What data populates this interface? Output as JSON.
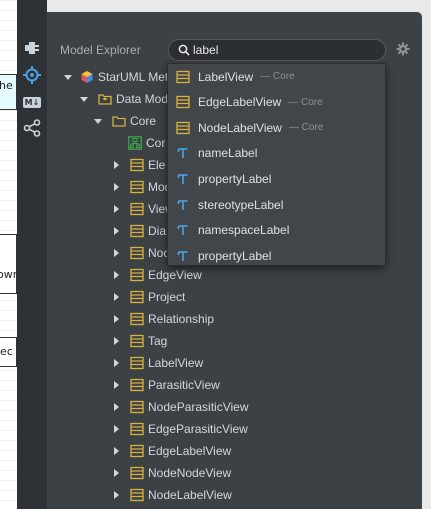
{
  "canvas": {
    "fragments": [
      "he",
      "own",
      "lec"
    ]
  },
  "panel": {
    "title": "Model Explorer",
    "search": {
      "value": "label",
      "placeholder": ""
    }
  },
  "tree": {
    "root": "StarUML Met",
    "data_model": "Data Mod",
    "core": "Core",
    "core_child": "Cor",
    "items": [
      "Ele",
      "Mod",
      "View",
      "Dia",
      "Noc",
      "EdgeView",
      "Project",
      "Relationship",
      "Tag",
      "LabelView",
      "ParasiticView",
      "NodeParasiticView",
      "EdgeParasiticView",
      "EdgeLabelView",
      "NodeNodeView",
      "NodeLabelView"
    ]
  },
  "dropdown": {
    "items": [
      {
        "label": "LabelView",
        "hint": "— Core",
        "kind": "class"
      },
      {
        "label": "EdgeLabelView",
        "hint": "— Core",
        "kind": "class"
      },
      {
        "label": "NodeLabelView",
        "hint": "— Core",
        "kind": "class"
      },
      {
        "label": "nameLabel",
        "hint": "",
        "kind": "attribute"
      },
      {
        "label": "propertyLabel",
        "hint": "",
        "kind": "attribute"
      },
      {
        "label": "stereotypeLabel",
        "hint": "",
        "kind": "attribute"
      },
      {
        "label": "namespaceLabel",
        "hint": "",
        "kind": "attribute"
      },
      {
        "label": "propertyLabel",
        "hint": "",
        "kind": "attribute"
      }
    ]
  },
  "toolbar": {
    "icons": [
      "extension-icon",
      "target-icon",
      "markdown-icon",
      "share-icon"
    ],
    "md_label": "M↓"
  },
  "colors": {
    "panel": "#3c4146",
    "class_icon": "#d8b13c",
    "attribute_icon": "#4aa3e6",
    "diagram_icon": "#3ea34a"
  }
}
